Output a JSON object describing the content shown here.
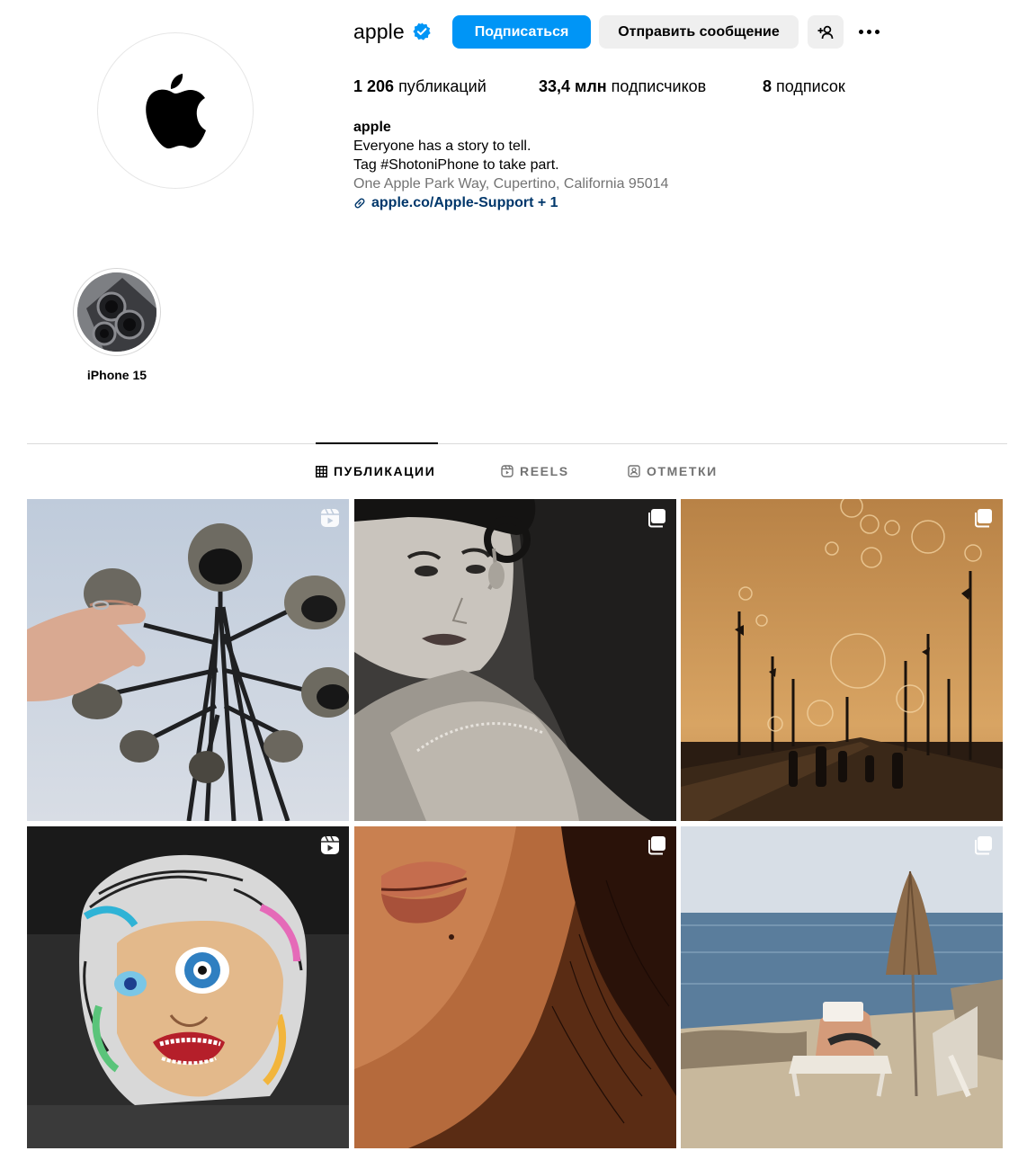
{
  "profile": {
    "username": "apple",
    "verified_icon": "verified-badge-icon",
    "follow_label": "Подписаться",
    "message_label": "Отправить сообщение",
    "add_user_icon": "add-user-icon",
    "more_icon": "more-options-icon"
  },
  "stats": {
    "posts_count": "1 206",
    "posts_label": "публикаций",
    "followers_count": "33,4 млн",
    "followers_label": "подписчиков",
    "following_count": "8",
    "following_label": "подписок"
  },
  "bio": {
    "name": "apple",
    "line1": "Everyone has a story to tell.",
    "line2": "Tag #ShotoniPhone to take part.",
    "address": "One Apple Park Way, Cupertino, California 95014",
    "link": "apple.co/Apple-Support + 1"
  },
  "highlights": [
    {
      "label": "iPhone 15"
    }
  ],
  "tabs": [
    {
      "label": "ПУБЛИКАЦИИ",
      "icon": "grid-icon",
      "active": true
    },
    {
      "label": "REELS",
      "icon": "reels-icon",
      "active": false
    },
    {
      "label": "ОТМЕТКИ",
      "icon": "tagged-icon",
      "active": false
    }
  ],
  "posts": [
    {
      "type": "reel",
      "badge_icon": "reel-icon"
    },
    {
      "type": "carousel",
      "badge_icon": "carousel-icon"
    },
    {
      "type": "carousel",
      "badge_icon": "carousel-icon"
    },
    {
      "type": "reel",
      "badge_icon": "reel-icon"
    },
    {
      "type": "carousel",
      "badge_icon": "carousel-icon"
    },
    {
      "type": "carousel",
      "badge_icon": "carousel-icon"
    }
  ],
  "colors": {
    "accent": "#0095f6",
    "secondary_button": "#efefef",
    "link": "#00376b",
    "muted_text": "#737373",
    "divider": "#dbdbdb"
  }
}
